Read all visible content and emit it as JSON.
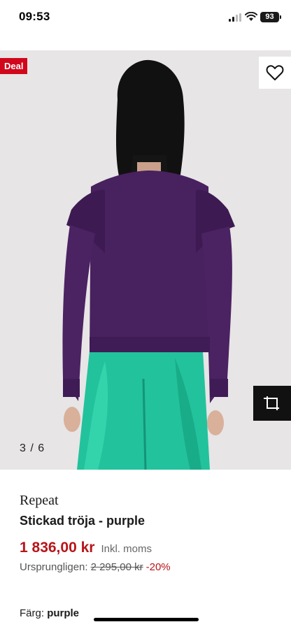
{
  "status": {
    "time": "09:53",
    "battery": "93"
  },
  "gallery": {
    "deal_badge": "Deal",
    "pager": "3 / 6"
  },
  "product": {
    "brand": "Repeat",
    "name": "Stickad tröja - purple",
    "price": "1 836,00 kr",
    "tax_note": "Inkl. moms",
    "original_label": "Ursprungligen:",
    "original_price": "2 295,00 kr",
    "discount": "-20%",
    "color_label": "Färg:",
    "color_value": "purple"
  },
  "colors": {
    "accent_red": "#b7151a",
    "badge_red": "#d1081c",
    "sweater": "#4a2466",
    "skirt": "#1fbf9a"
  },
  "icons": [
    "signal-icon",
    "wifi-icon",
    "heart-icon",
    "ar-view-icon"
  ]
}
